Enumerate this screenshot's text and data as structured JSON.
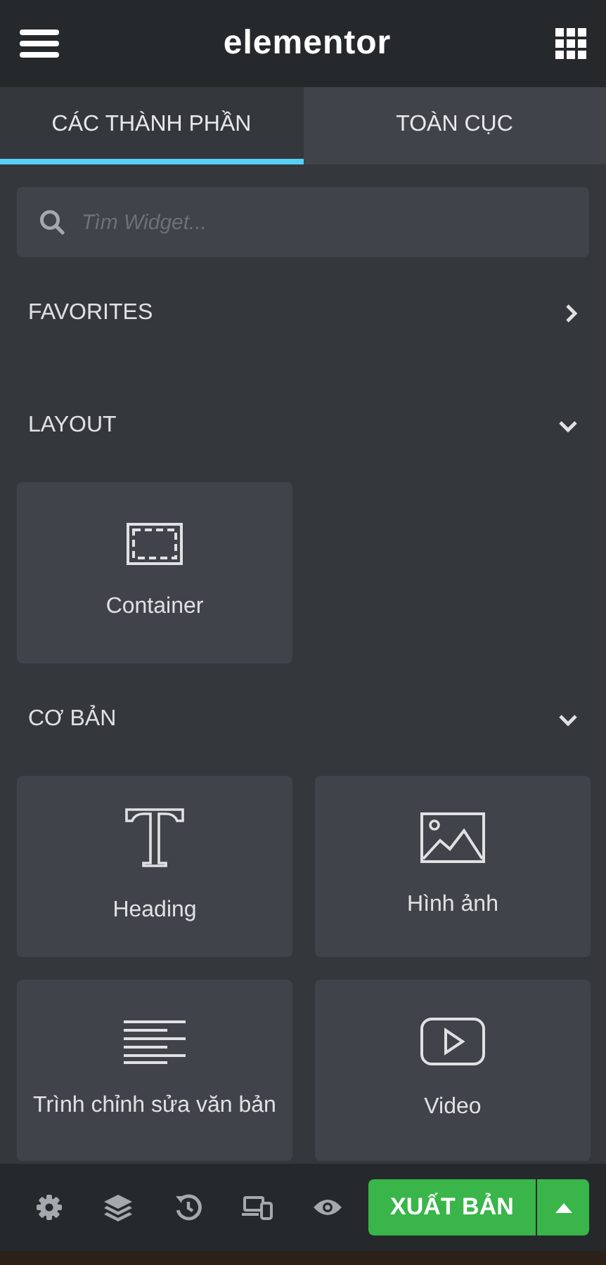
{
  "header": {
    "title": "elementor"
  },
  "tabs": [
    {
      "label": "CÁC THÀNH PHẦN",
      "selected": true
    },
    {
      "label": "TOÀN CỤC",
      "selected": false
    }
  ],
  "search": {
    "placeholder": "Tìm Widget..."
  },
  "sections": [
    {
      "title": "FAVORITES",
      "expanded": false
    },
    {
      "title": "LAYOUT",
      "expanded": true,
      "widgets": [
        {
          "label": "Container",
          "kind": "container"
        }
      ]
    },
    {
      "title": "CƠ BẢN",
      "expanded": true,
      "widgets": [
        {
          "label": "Heading",
          "kind": "heading"
        },
        {
          "label": "Hình ảnh",
          "kind": "image"
        },
        {
          "label": "Trình chỉnh sửa văn bản",
          "kind": "text"
        },
        {
          "label": "Video",
          "kind": "video"
        }
      ]
    }
  ],
  "footer": {
    "publish_button": "XUẤT BẢN"
  }
}
